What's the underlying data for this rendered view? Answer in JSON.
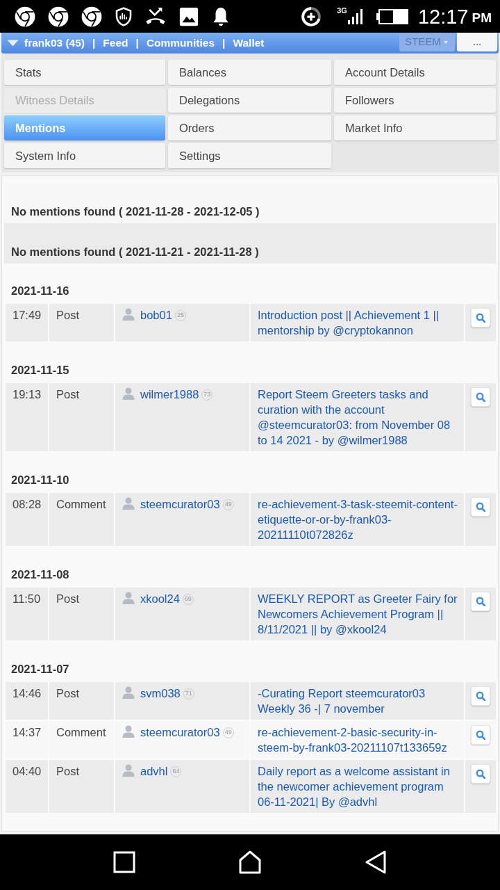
{
  "status_bar": {
    "network": "3G",
    "time": "12:17",
    "period": "PM"
  },
  "navbar": {
    "items": [
      {
        "kind": "account",
        "label": "frank03 (45)"
      },
      {
        "kind": "separator",
        "label": "|"
      },
      {
        "kind": "link",
        "label": "Feed"
      },
      {
        "kind": "separator",
        "label": "|"
      },
      {
        "kind": "link",
        "label": "Communities"
      },
      {
        "kind": "separator",
        "label": "|"
      },
      {
        "kind": "link",
        "label": "Wallet"
      }
    ],
    "currency": "STEEM",
    "more": "..."
  },
  "tabs": [
    {
      "label": "Stats",
      "selected": false,
      "disabled": false
    },
    {
      "label": "Balances",
      "selected": false,
      "disabled": false
    },
    {
      "label": "Account Details",
      "selected": false,
      "disabled": false
    },
    {
      "label": "Witness Details",
      "selected": false,
      "disabled": true
    },
    {
      "label": "Delegations",
      "selected": false,
      "disabled": false
    },
    {
      "label": "Followers",
      "selected": false,
      "disabled": false
    },
    {
      "label": "Mentions",
      "selected": true,
      "disabled": false
    },
    {
      "label": "Orders",
      "selected": false,
      "disabled": false
    },
    {
      "label": "Market Info",
      "selected": false,
      "disabled": false
    },
    {
      "label": "System Info",
      "selected": false,
      "disabled": false
    },
    {
      "label": "Settings",
      "selected": false,
      "disabled": false
    }
  ],
  "sections": [
    {
      "kind": "empty",
      "text": "No mentions found ( 2021-11-28 - 2021-12-05 )"
    },
    {
      "kind": "empty",
      "text": "No mentions found ( 2021-11-21 - 2021-11-28 )"
    },
    {
      "kind": "day",
      "date": "2021-11-16",
      "rows": [
        {
          "time": "17:49",
          "type": "Post",
          "author": "bob01",
          "reputation": "25",
          "title": "Introduction post || Achievement 1 || mentorship by @cryptokannon"
        }
      ]
    },
    {
      "kind": "day",
      "date": "2021-11-15",
      "rows": [
        {
          "time": "19:13",
          "type": "Post",
          "author": "wilmer1988",
          "reputation": "73",
          "title": "Report Steem Greeters tasks and curation with the account @steemcurator03: from November 08 to 14 2021 - by @wilmer1988"
        }
      ]
    },
    {
      "kind": "day",
      "date": "2021-11-10",
      "rows": [
        {
          "time": "08:28",
          "type": "Comment",
          "author": "steemcurator03",
          "reputation": "49",
          "title": "re-achievement-3-task-steemit-content-etiquette-or-or-by-frank03-20211110t072826z"
        }
      ]
    },
    {
      "kind": "day",
      "date": "2021-11-08",
      "rows": [
        {
          "time": "11:50",
          "type": "Post",
          "author": "xkool24",
          "reputation": "69",
          "title": "WEEKLY REPORT as Greeter Fairy for Newcomers Achievement Program || 8/11/2021 || by @xkool24"
        }
      ]
    },
    {
      "kind": "day",
      "date": "2021-11-07",
      "rows": [
        {
          "time": "14:46",
          "type": "Post",
          "author": "svm038",
          "reputation": "71",
          "title": "-Curating Report steemcurator03 Weekly 36 -| 7 november"
        },
        {
          "time": "14:37",
          "type": "Comment",
          "author": "steemcurator03",
          "reputation": "49",
          "title": "re-achievement-2-basic-security-in-steem-by-frank03-20211107t133659z"
        },
        {
          "time": "04:40",
          "type": "Post",
          "author": "advhl",
          "reputation": "64",
          "title": "Daily report as a welcome assistant in the newcomer achievement program 06-11-2021| By @advhl"
        }
      ]
    }
  ]
}
